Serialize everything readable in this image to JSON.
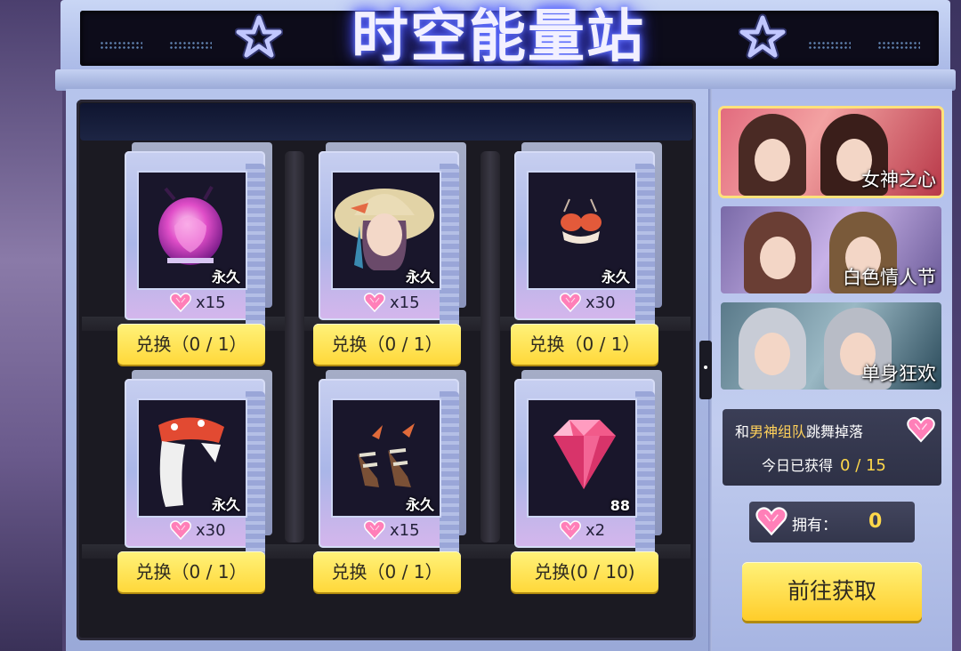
{
  "header": {
    "title": "时空能量站"
  },
  "items": [
    {
      "name": "pink-mask",
      "tag": "永久",
      "cost": "x15",
      "button": "兑换（0 / 1）"
    },
    {
      "name": "sun-hat",
      "tag": "永久",
      "cost": "x15",
      "button": "兑换（0 / 1）"
    },
    {
      "name": "bikini-top",
      "tag": "永久",
      "cost": "x30",
      "button": "兑换（0 / 1）"
    },
    {
      "name": "veil-headpiece",
      "tag": "永久",
      "cost": "x30",
      "button": "兑换（0 / 1）"
    },
    {
      "name": "sandals",
      "tag": "永久",
      "cost": "x15",
      "button": "兑换（0 / 1）"
    },
    {
      "name": "diamond",
      "tag": "88",
      "cost": "x2",
      "button": "兑换(0 / 10)"
    }
  ],
  "banners": [
    {
      "label": "女神之心",
      "active": true
    },
    {
      "label": "白色情人节",
      "active": false
    },
    {
      "label": "单身狂欢",
      "active": false
    }
  ],
  "info": {
    "prefix": "和",
    "highlight": "男神组队",
    "suffix": "跳舞掉落",
    "today_label": "今日已获得",
    "today_count": "0 / 15"
  },
  "owned": {
    "label": "拥有：",
    "value": "0"
  },
  "go_button": "前往获取",
  "colors": {
    "button_yellow": "#ffd83a",
    "count_yellow": "#ffd84a",
    "highlight": "#ffd15a"
  }
}
